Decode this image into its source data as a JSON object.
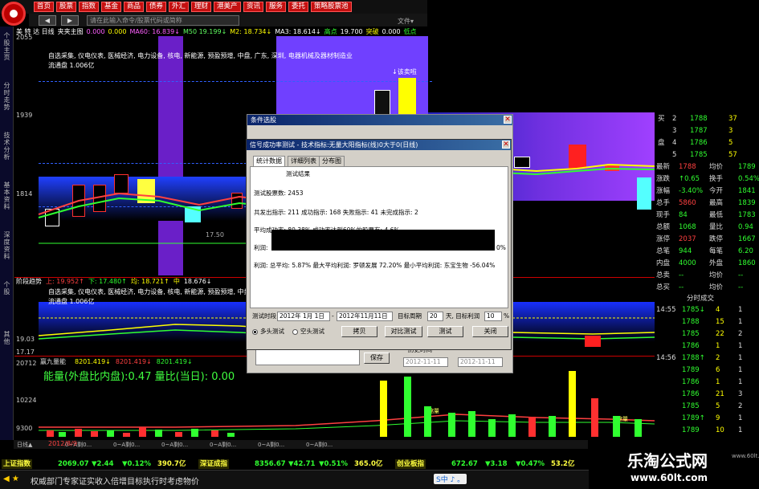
{
  "colors": {
    "up": "#ff3030",
    "down": "#54ffff",
    "yellow": "#ffff00",
    "white": "#ffffff",
    "magenta": "#ff40ff",
    "green": "#30ff30",
    "menu_red": "#c41010"
  },
  "menu": [
    "首页",
    "股票",
    "指数",
    "基金",
    "商品",
    "债券",
    "外汇",
    "理财",
    "港美产",
    "资讯",
    "服务",
    "委托",
    "策略股票池"
  ],
  "toolbar": {
    "back": "◀",
    "forward": "▶",
    "address": "请在此输入命令/股票代码或简称",
    "right_label": "文件▾"
  },
  "sidebar": [
    "个股主页",
    "分时走势",
    "技术分析",
    "基本资料",
    "深度资料",
    "个股",
    "其他"
  ],
  "main_chart": {
    "legend": [
      "美 特 达 日线",
      "夹夹主图",
      "0.000",
      "0.000",
      "MA60: 16.839↓",
      "M50 19.199↓",
      "M2: 18.734↓",
      "MA3: 18.614↓",
      "高点",
      "19.700",
      "突破",
      "0.000",
      "低点"
    ],
    "price_top": "2055",
    "price_mid1": "1939",
    "price_mid2": "1814",
    "info_line1": "自选采集, 仪电仪表, 医械经济, 电力设备, 核电, 新能源, 预盈预增, 中盘, 广东, 深圳, 电器机械及器材制造业",
    "info_line2": "流通盘 1.006亿",
    "sell_label": "↓该卖啦",
    "price_1750": "17.50"
  },
  "mid_chart": {
    "legend": [
      "阶段趋势",
      "上: 19.952↑",
      "下: 17.480↑",
      "均: 18.721↑",
      "中",
      "18.676↓"
    ],
    "info_line1": "自选采集, 仪电仪表, 医械经济, 电力设备, 核电, 新能源, 预盈预增, 中盘, 广东, 深圳, 电器机械及器材制造业",
    "info_line2": "流通盘 1.006亿",
    "lab1": "19.03",
    "lab2": "17.17"
  },
  "vol_chart": {
    "legend": "赢九量能",
    "legend_vals": [
      "8201.419↓",
      "8201.419↓",
      "8201.419↓"
    ],
    "big_text": "能量(外盘比内盘):0.47    量比(当日): 0.00",
    "lab1": "20712",
    "lab2": "10224",
    "lab3": "9300",
    "small_labels": [
      "缩量",
      "缩量",
      "缩量",
      "缩量"
    ]
  },
  "dialog_back": {
    "title": "条件选股",
    "dates": [
      "2012-11-11",
      "2012-11-11"
    ],
    "checkbox": "历史时间",
    "save": "保存"
  },
  "dialog": {
    "title": "信号成功率测试 - 技术指标:无量大阳指标(线)0大于0(日线)",
    "tabs": [
      "统计数据",
      "详细列表",
      "分布图"
    ],
    "section": "测试结果",
    "lines": [
      "测试股票数: 2453",
      "共发出指示: 211  成功指示: 168  失败指示: 41  未完成指示: 2",
      "平均成功率: 80.38%   成功率达到60%的股票有: 4.6%",
      "利润:",
      "利润: 总平均: 5.87%  最大平均利润: 罗顿发展 72.20%  最小平均利润: 东宝生物 -56.04%"
    ],
    "pct_right": "0%",
    "period_label": "测试时段",
    "start": "2012年 1月 1日",
    "end": "2012年11月11日",
    "target_label": "目标周期",
    "target_val": "20",
    "target_unit": "天, 目标利润",
    "profit_val": "10",
    "profit_unit": "%",
    "mode_long": "多头测试",
    "mode_short": "空头测试",
    "buttons": [
      "拷贝",
      "对比测试",
      "测试",
      "关闭"
    ]
  },
  "quote": {
    "buy_label": "买",
    "sell_label": "盘",
    "levels": [
      {
        "n": "2",
        "p": "1788",
        "v": "37"
      },
      {
        "n": "3",
        "p": "1787",
        "v": "3"
      },
      {
        "n": "4",
        "p": "1786",
        "v": "5"
      },
      {
        "n": "5",
        "p": "1785",
        "v": "57"
      }
    ],
    "stats": [
      [
        "最新",
        "1788",
        "均价",
        "1789"
      ],
      [
        "涨跌",
        "↑0.65",
        "换手",
        "0.54%"
      ],
      [
        "涨幅",
        "-3.40%",
        "今开",
        "1841"
      ],
      [
        "总手",
        "5860",
        "最高",
        "1839"
      ],
      [
        "现手",
        "84",
        "最低",
        "1783"
      ],
      [
        "总额",
        "1068",
        "量比",
        "0.94"
      ],
      [
        "涨停",
        "2037",
        "跌停",
        "1667"
      ],
      [
        "总笔",
        "944",
        "每笔",
        "6.20"
      ],
      [
        "内盘",
        "4000",
        "外盘",
        "1860"
      ],
      [
        "总卖",
        "--",
        "均价",
        "--"
      ],
      [
        "总买",
        "--",
        "均价",
        "--"
      ]
    ],
    "ticks_title": "分时成交",
    "ticks": [
      [
        "14:55",
        "1785↓",
        "4",
        "1"
      ],
      [
        "",
        "1788",
        "15",
        "1"
      ],
      [
        "",
        "1785",
        "22",
        "2"
      ],
      [
        "",
        "1786",
        "1",
        "1"
      ],
      [
        "14:56",
        "1788↑",
        "2",
        "1"
      ],
      [
        "",
        "1789",
        "6",
        "1"
      ],
      [
        "",
        "1786",
        "1",
        "1"
      ],
      [
        "",
        "1786",
        "21",
        "3"
      ],
      [
        "",
        "1785",
        "5",
        "2"
      ],
      [
        "",
        "1789↑",
        "9",
        "1"
      ],
      [
        "",
        "1789",
        "10",
        "1"
      ]
    ]
  },
  "bottom_tabs": [
    "日线▲",
    "0~A剩0...",
    "0~A剩0...",
    "0~A剩0...",
    "0~A剩0...",
    "0~A剩0...",
    "0~A剩0..."
  ],
  "date_label": "2012/8/9",
  "indices": [
    {
      "name": "上证指数",
      "v": "2069.07",
      "c": "▼2.44",
      "p": "▼0.12%",
      "a": "390.7亿"
    },
    {
      "name": "深证成指",
      "v": "8356.67",
      "c": "▼42.71",
      "p": "▼0.51%",
      "a": "365.0亿"
    },
    {
      "name": "创业板指",
      "v": "672.67",
      "c": "▼3.18",
      "p": "▼0.47%",
      "a": "53.2亿"
    }
  ],
  "ticker": {
    "arrow": "◀ ★",
    "text": "权威部门专家证实收入倍增目标执行时考虑物价",
    "ime": "S中 ♪ 。"
  },
  "brand": {
    "title": "乐淘公式网",
    "url": "www.60lt.com",
    "url2": "www.60lt.com"
  }
}
